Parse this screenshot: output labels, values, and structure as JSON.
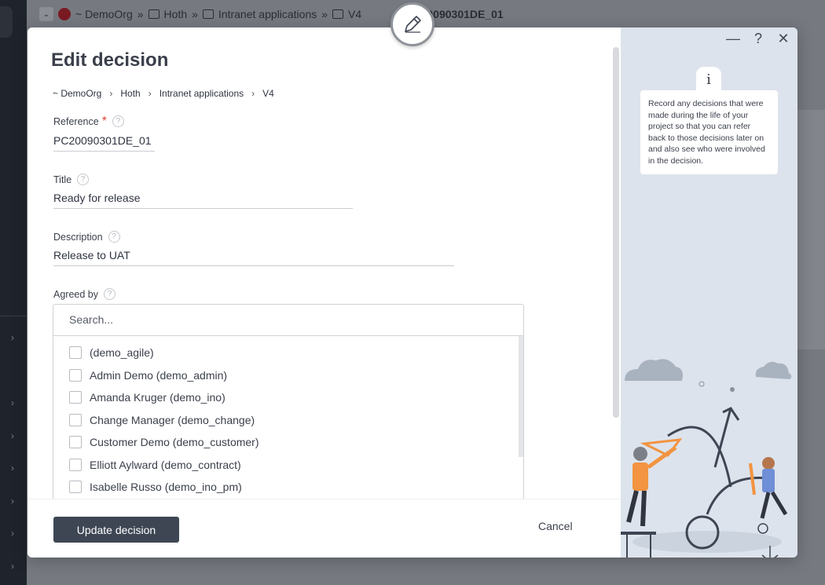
{
  "background": {
    "breadcrumb": [
      "~ DemoOrg",
      "Hoth",
      "Intranet applications",
      "V4",
      "PC20090301DE_01"
    ]
  },
  "modal": {
    "title": "Edit decision",
    "breadcrumb": [
      "~ DemoOrg",
      "Hoth",
      "Intranet applications",
      "V4"
    ],
    "reference": {
      "label": "Reference",
      "value": "PC20090301DE_01"
    },
    "title_field": {
      "label": "Title",
      "value": "Ready for release"
    },
    "description": {
      "label": "Description",
      "value": "Release to UAT"
    },
    "agreed_by": {
      "label": "Agreed by",
      "search_placeholder": "Search...",
      "options": [
        "(demo_agile)",
        "Admin Demo (demo_admin)",
        "Amanda Kruger (demo_ino)",
        "Change Manager (demo_change)",
        "Customer Demo (demo_customer)",
        "Elliott Aylward (demo_contract)",
        "Isabelle Russo (demo_ino_pm)"
      ]
    },
    "buttons": {
      "update": "Update decision",
      "cancel": "Cancel"
    },
    "help_glyph": "?",
    "window_controls": {
      "minimize": "—",
      "help": "?",
      "close": "✕"
    },
    "info": {
      "glyph": "i",
      "text": "Record any decisions that were made during the life of your project so that you can refer back to those decisions later on and also see who were involved in the decision."
    }
  },
  "colors": {
    "primary_button": "#3e4654",
    "required": "#e0453a",
    "side_panel": "#dde3ec"
  }
}
